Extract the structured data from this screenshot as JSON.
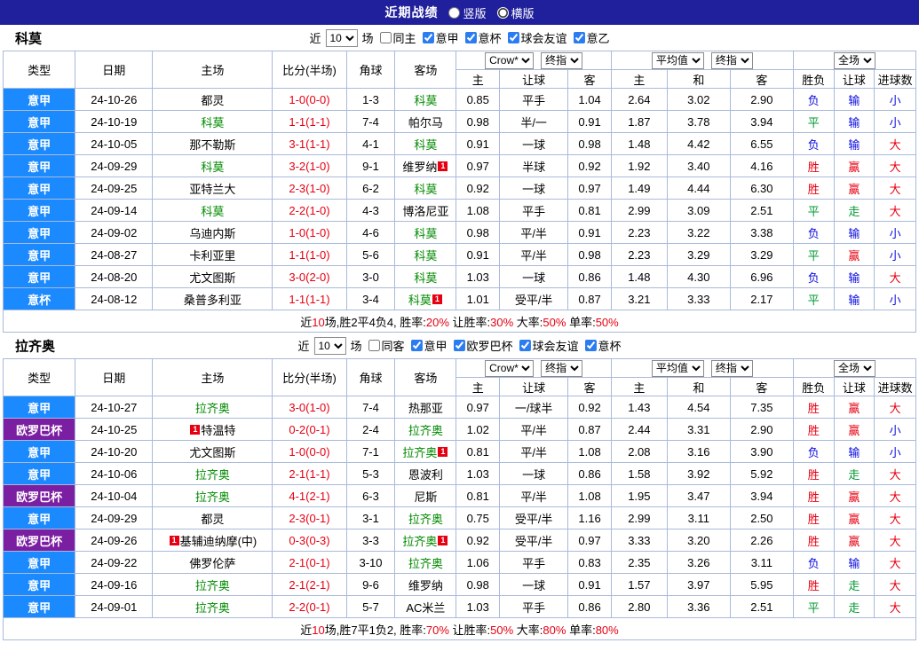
{
  "topbar": {
    "title": "近期战绩",
    "layout_options": [
      {
        "label": "竖版",
        "selected": false
      },
      {
        "label": "横版",
        "selected": true
      }
    ]
  },
  "table_header": {
    "main_columns": [
      "类型",
      "日期",
      "主场",
      "比分(半场)",
      "角球",
      "客场"
    ],
    "sub_columns": [
      "主",
      "让球",
      "客",
      "主",
      "和",
      "客",
      "胜负",
      "让球",
      "进球数"
    ],
    "selects": {
      "bookmaker": "Crow*",
      "bookmaker_index": "终指",
      "average": "平均值",
      "average_index": "终指",
      "scope": "全场"
    }
  },
  "colors": {
    "topbar_bg": "#20209c",
    "league_blue": "#1b8aff",
    "league_purple": "#7b1fa2",
    "win_red": "#e60012",
    "draw_green": "#009933",
    "lose_blue": "#0b0be0",
    "focus_team_green": "#008a00",
    "grid_border": "#a9badb"
  },
  "sections": [
    {
      "team": "科莫",
      "filters": {
        "prefix": "近",
        "count": "10",
        "suffix": "场",
        "venue": {
          "label": "同主",
          "checked": false
        },
        "leagues": [
          {
            "label": "意甲",
            "checked": true
          },
          {
            "label": "意杯",
            "checked": true
          },
          {
            "label": "球会友谊",
            "checked": true
          },
          {
            "label": "意乙",
            "checked": true
          }
        ]
      },
      "rows": [
        {
          "league": "意甲",
          "lc": "blue",
          "date": "24-10-26",
          "home": "都灵",
          "hg": false,
          "hb": "",
          "score": "1-0(0-0)",
          "corners": "1-3",
          "away": "科莫",
          "ag": true,
          "ab": "",
          "odds": [
            "0.85",
            "平手",
            "1.04"
          ],
          "avg": [
            "2.64",
            "3.02",
            "2.90"
          ],
          "res": [
            [
              "负",
              "blue"
            ],
            [
              "输",
              "blue"
            ],
            [
              "小",
              "blue"
            ]
          ]
        },
        {
          "league": "意甲",
          "lc": "blue",
          "date": "24-10-19",
          "home": "科莫",
          "hg": true,
          "hb": "",
          "score": "1-1(1-1)",
          "corners": "7-4",
          "away": "帕尔马",
          "ag": false,
          "ab": "",
          "odds": [
            "0.98",
            "半/一",
            "0.91"
          ],
          "avg": [
            "1.87",
            "3.78",
            "3.94"
          ],
          "res": [
            [
              "平",
              "green"
            ],
            [
              "输",
              "blue"
            ],
            [
              "小",
              "blue"
            ]
          ]
        },
        {
          "league": "意甲",
          "lc": "blue",
          "date": "24-10-05",
          "home": "那不勒斯",
          "hg": false,
          "hb": "",
          "score": "3-1(1-1)",
          "corners": "4-1",
          "away": "科莫",
          "ag": true,
          "ab": "",
          "odds": [
            "0.91",
            "一球",
            "0.98"
          ],
          "avg": [
            "1.48",
            "4.42",
            "6.55"
          ],
          "res": [
            [
              "负",
              "blue"
            ],
            [
              "输",
              "blue"
            ],
            [
              "大",
              "red"
            ]
          ]
        },
        {
          "league": "意甲",
          "lc": "blue",
          "date": "24-09-29",
          "home": "科莫",
          "hg": true,
          "hb": "",
          "score": "3-2(1-0)",
          "corners": "9-1",
          "away": "维罗纳",
          "ag": false,
          "ab": "1",
          "odds": [
            "0.97",
            "半球",
            "0.92"
          ],
          "avg": [
            "1.92",
            "3.40",
            "4.16"
          ],
          "res": [
            [
              "胜",
              "red"
            ],
            [
              "赢",
              "red"
            ],
            [
              "大",
              "red"
            ]
          ]
        },
        {
          "league": "意甲",
          "lc": "blue",
          "date": "24-09-25",
          "home": "亚特兰大",
          "hg": false,
          "hb": "",
          "score": "2-3(1-0)",
          "corners": "6-2",
          "away": "科莫",
          "ag": true,
          "ab": "",
          "odds": [
            "0.92",
            "一球",
            "0.97"
          ],
          "avg": [
            "1.49",
            "4.44",
            "6.30"
          ],
          "res": [
            [
              "胜",
              "red"
            ],
            [
              "赢",
              "red"
            ],
            [
              "大",
              "red"
            ]
          ]
        },
        {
          "league": "意甲",
          "lc": "blue",
          "date": "24-09-14",
          "home": "科莫",
          "hg": true,
          "hb": "",
          "score": "2-2(1-0)",
          "corners": "4-3",
          "away": "博洛尼亚",
          "ag": false,
          "ab": "",
          "odds": [
            "1.08",
            "平手",
            "0.81"
          ],
          "avg": [
            "2.99",
            "3.09",
            "2.51"
          ],
          "res": [
            [
              "平",
              "green"
            ],
            [
              "走",
              "green"
            ],
            [
              "大",
              "red"
            ]
          ]
        },
        {
          "league": "意甲",
          "lc": "blue",
          "date": "24-09-02",
          "home": "乌迪内斯",
          "hg": false,
          "hb": "",
          "score": "1-0(1-0)",
          "corners": "4-6",
          "away": "科莫",
          "ag": true,
          "ab": "",
          "odds": [
            "0.98",
            "平/半",
            "0.91"
          ],
          "avg": [
            "2.23",
            "3.22",
            "3.38"
          ],
          "res": [
            [
              "负",
              "blue"
            ],
            [
              "输",
              "blue"
            ],
            [
              "小",
              "blue"
            ]
          ]
        },
        {
          "league": "意甲",
          "lc": "blue",
          "date": "24-08-27",
          "home": "卡利亚里",
          "hg": false,
          "hb": "",
          "score": "1-1(1-0)",
          "corners": "5-6",
          "away": "科莫",
          "ag": true,
          "ab": "",
          "odds": [
            "0.91",
            "平/半",
            "0.98"
          ],
          "avg": [
            "2.23",
            "3.29",
            "3.29"
          ],
          "res": [
            [
              "平",
              "green"
            ],
            [
              "赢",
              "red"
            ],
            [
              "小",
              "blue"
            ]
          ]
        },
        {
          "league": "意甲",
          "lc": "blue",
          "date": "24-08-20",
          "home": "尤文图斯",
          "hg": false,
          "hb": "",
          "score": "3-0(2-0)",
          "corners": "3-0",
          "away": "科莫",
          "ag": true,
          "ab": "",
          "odds": [
            "1.03",
            "一球",
            "0.86"
          ],
          "avg": [
            "1.48",
            "4.30",
            "6.96"
          ],
          "res": [
            [
              "负",
              "blue"
            ],
            [
              "输",
              "blue"
            ],
            [
              "大",
              "red"
            ]
          ]
        },
        {
          "league": "意杯",
          "lc": "blue",
          "date": "24-08-12",
          "home": "桑普多利亚",
          "hg": false,
          "hb": "",
          "score": "1-1(1-1)",
          "corners": "3-4",
          "away": "科莫",
          "ag": true,
          "ab": "1",
          "odds": [
            "1.01",
            "受平/半",
            "0.87"
          ],
          "avg": [
            "3.21",
            "3.33",
            "2.17"
          ],
          "res": [
            [
              "平",
              "green"
            ],
            [
              "输",
              "blue"
            ],
            [
              "小",
              "blue"
            ]
          ]
        }
      ],
      "footer": [
        {
          "t": "近",
          "red": false
        },
        {
          "t": "10",
          "red": true
        },
        {
          "t": "场,胜2平4负4, 胜率:",
          "red": false
        },
        {
          "t": "20%",
          "red": true
        },
        {
          "t": " 让胜率:",
          "red": false
        },
        {
          "t": "30%",
          "red": true
        },
        {
          "t": " 大率:",
          "red": false
        },
        {
          "t": "50%",
          "red": true
        },
        {
          "t": " 单率:",
          "red": false
        },
        {
          "t": "50%",
          "red": true
        }
      ]
    },
    {
      "team": "拉齐奥",
      "filters": {
        "prefix": "近",
        "count": "10",
        "suffix": "场",
        "venue": {
          "label": "同客",
          "checked": false
        },
        "leagues": [
          {
            "label": "意甲",
            "checked": true
          },
          {
            "label": "欧罗巴杯",
            "checked": true
          },
          {
            "label": "球会友谊",
            "checked": true
          },
          {
            "label": "意杯",
            "checked": true
          }
        ]
      },
      "rows": [
        {
          "league": "意甲",
          "lc": "blue",
          "date": "24-10-27",
          "home": "拉齐奥",
          "hg": true,
          "hb": "",
          "score": "3-0(1-0)",
          "corners": "7-4",
          "away": "热那亚",
          "ag": false,
          "ab": "",
          "odds": [
            "0.97",
            "一/球半",
            "0.92"
          ],
          "avg": [
            "1.43",
            "4.54",
            "7.35"
          ],
          "res": [
            [
              "胜",
              "red"
            ],
            [
              "赢",
              "red"
            ],
            [
              "大",
              "red"
            ]
          ]
        },
        {
          "league": "欧罗巴杯",
          "lc": "purple",
          "date": "24-10-25",
          "home": "特温特",
          "hg": false,
          "hb": "1",
          "score": "0-2(0-1)",
          "corners": "2-4",
          "away": "拉齐奥",
          "ag": true,
          "ab": "",
          "odds": [
            "1.02",
            "平/半",
            "0.87"
          ],
          "avg": [
            "2.44",
            "3.31",
            "2.90"
          ],
          "res": [
            [
              "胜",
              "red"
            ],
            [
              "赢",
              "red"
            ],
            [
              "小",
              "blue"
            ]
          ]
        },
        {
          "league": "意甲",
          "lc": "blue",
          "date": "24-10-20",
          "home": "尤文图斯",
          "hg": false,
          "hb": "",
          "score": "1-0(0-0)",
          "corners": "7-1",
          "away": "拉齐奥",
          "ag": true,
          "ab": "1",
          "odds": [
            "0.81",
            "平/半",
            "1.08"
          ],
          "avg": [
            "2.08",
            "3.16",
            "3.90"
          ],
          "res": [
            [
              "负",
              "blue"
            ],
            [
              "输",
              "blue"
            ],
            [
              "小",
              "blue"
            ]
          ]
        },
        {
          "league": "意甲",
          "lc": "blue",
          "date": "24-10-06",
          "home": "拉齐奥",
          "hg": true,
          "hb": "",
          "score": "2-1(1-1)",
          "corners": "5-3",
          "away": "恩波利",
          "ag": false,
          "ab": "",
          "odds": [
            "1.03",
            "一球",
            "0.86"
          ],
          "avg": [
            "1.58",
            "3.92",
            "5.92"
          ],
          "res": [
            [
              "胜",
              "red"
            ],
            [
              "走",
              "green"
            ],
            [
              "大",
              "red"
            ]
          ]
        },
        {
          "league": "欧罗巴杯",
          "lc": "purple",
          "date": "24-10-04",
          "home": "拉齐奥",
          "hg": true,
          "hb": "",
          "score": "4-1(2-1)",
          "corners": "6-3",
          "away": "尼斯",
          "ag": false,
          "ab": "",
          "odds": [
            "0.81",
            "平/半",
            "1.08"
          ],
          "avg": [
            "1.95",
            "3.47",
            "3.94"
          ],
          "res": [
            [
              "胜",
              "red"
            ],
            [
              "赢",
              "red"
            ],
            [
              "大",
              "red"
            ]
          ]
        },
        {
          "league": "意甲",
          "lc": "blue",
          "date": "24-09-29",
          "home": "都灵",
          "hg": false,
          "hb": "",
          "score": "2-3(0-1)",
          "corners": "3-1",
          "away": "拉齐奥",
          "ag": true,
          "ab": "",
          "odds": [
            "0.75",
            "受平/半",
            "1.16"
          ],
          "avg": [
            "2.99",
            "3.11",
            "2.50"
          ],
          "res": [
            [
              "胜",
              "red"
            ],
            [
              "赢",
              "red"
            ],
            [
              "大",
              "red"
            ]
          ]
        },
        {
          "league": "欧罗巴杯",
          "lc": "purple",
          "date": "24-09-26",
          "home": "基辅迪纳摩(中)",
          "hg": false,
          "hb": "1",
          "score": "0-3(0-3)",
          "corners": "3-3",
          "away": "拉齐奥",
          "ag": true,
          "ab": "1",
          "odds": [
            "0.92",
            "受平/半",
            "0.97"
          ],
          "avg": [
            "3.33",
            "3.20",
            "2.26"
          ],
          "res": [
            [
              "胜",
              "red"
            ],
            [
              "赢",
              "red"
            ],
            [
              "大",
              "red"
            ]
          ]
        },
        {
          "league": "意甲",
          "lc": "blue",
          "date": "24-09-22",
          "home": "佛罗伦萨",
          "hg": false,
          "hb": "",
          "score": "2-1(0-1)",
          "corners": "3-10",
          "away": "拉齐奥",
          "ag": true,
          "ab": "",
          "odds": [
            "1.06",
            "平手",
            "0.83"
          ],
          "avg": [
            "2.35",
            "3.26",
            "3.11"
          ],
          "res": [
            [
              "负",
              "blue"
            ],
            [
              "输",
              "blue"
            ],
            [
              "大",
              "red"
            ]
          ]
        },
        {
          "league": "意甲",
          "lc": "blue",
          "date": "24-09-16",
          "home": "拉齐奥",
          "hg": true,
          "hb": "",
          "score": "2-1(2-1)",
          "corners": "9-6",
          "away": "维罗纳",
          "ag": false,
          "ab": "",
          "odds": [
            "0.98",
            "一球",
            "0.91"
          ],
          "avg": [
            "1.57",
            "3.97",
            "5.95"
          ],
          "res": [
            [
              "胜",
              "red"
            ],
            [
              "走",
              "green"
            ],
            [
              "大",
              "red"
            ]
          ]
        },
        {
          "league": "意甲",
          "lc": "blue",
          "date": "24-09-01",
          "home": "拉齐奥",
          "hg": true,
          "hb": "",
          "score": "2-2(0-1)",
          "corners": "5-7",
          "away": "AC米兰",
          "ag": false,
          "ab": "",
          "odds": [
            "1.03",
            "平手",
            "0.86"
          ],
          "avg": [
            "2.80",
            "3.36",
            "2.51"
          ],
          "res": [
            [
              "平",
              "green"
            ],
            [
              "走",
              "green"
            ],
            [
              "大",
              "red"
            ]
          ]
        }
      ],
      "footer": [
        {
          "t": "近",
          "red": false
        },
        {
          "t": "10",
          "red": true
        },
        {
          "t": "场,胜7平1负2, 胜率:",
          "red": false
        },
        {
          "t": "70%",
          "red": true
        },
        {
          "t": " 让胜率:",
          "red": false
        },
        {
          "t": "50%",
          "red": true
        },
        {
          "t": " 大率:",
          "red": false
        },
        {
          "t": "80%",
          "red": true
        },
        {
          "t": " 单率:",
          "red": false
        },
        {
          "t": "80%",
          "red": true
        }
      ]
    }
  ]
}
